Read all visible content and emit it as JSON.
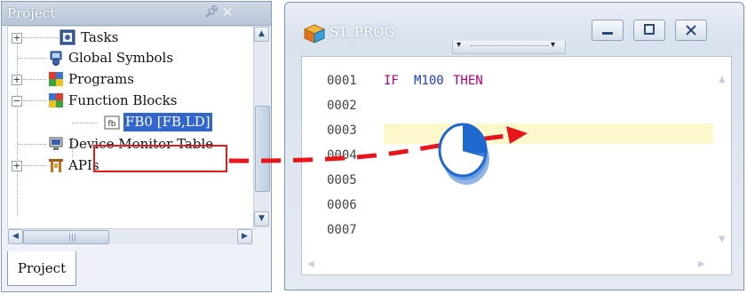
{
  "project_panel": {
    "title": "Project",
    "tab_label": "Project",
    "tree": [
      {
        "label": "Tasks",
        "expander": "+"
      },
      {
        "label": "Global Symbols"
      },
      {
        "label": "Programs",
        "expander": "+"
      },
      {
        "label": "Function Blocks",
        "expander": "−"
      },
      {
        "label": "FB0 [FB,LD]",
        "selected": true
      },
      {
        "label": "Device Monitor Table"
      },
      {
        "label": "APIs",
        "expander": "+"
      }
    ]
  },
  "st_window": {
    "title": "ST_PROG",
    "line_numbers": [
      "0001",
      "0002",
      "0003",
      "0004",
      "0005",
      "0006",
      "0007"
    ],
    "code_line_1": {
      "kw1": "IF",
      "var": "M100",
      "kw2": "THEN"
    }
  },
  "colors": {
    "keyword": "#b0007a",
    "variable": "#1f3fb0",
    "drag_arrow": "#e8161c",
    "selection_box": "#e21b1b",
    "highlight_line": "#fcf8cc"
  },
  "icons": [
    "tasks-icon",
    "global-symbols-icon",
    "programs-icon",
    "function-blocks-icon",
    "fb-icon",
    "device-monitor-icon",
    "apis-icon",
    "drag-cursor-icon"
  ]
}
